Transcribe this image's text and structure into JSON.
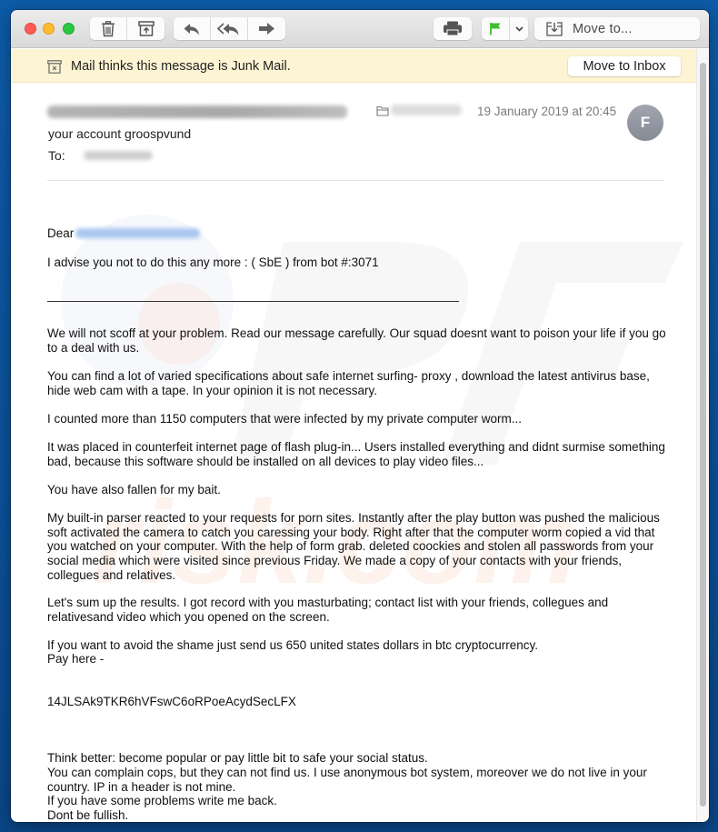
{
  "toolbar": {
    "buttons": [
      "trash",
      "archive",
      "reply",
      "reply-all",
      "forward",
      "print",
      "flag",
      "flag-menu"
    ],
    "move_to_label": "Move to...",
    "flag_color": "#3fbf2f"
  },
  "junk_banner": {
    "message": "Mail thinks this message is Junk Mail.",
    "move_to_inbox_label": "Move to Inbox",
    "background": "#fdf4d3"
  },
  "header": {
    "from": "[redacted sender]",
    "subject": "your account groospvund",
    "to_label": "To:",
    "to_value": "[redacted recipient]",
    "folder": "[redacted folder]",
    "date": "19 January 2019 at 20:45",
    "avatar_initial": "F"
  },
  "message": {
    "greeting": "Dear",
    "greeting_recipient": "[redacted email]",
    "line1": "I advise you not to do this any more :  ( SbE ) from bot #:3071",
    "paragraphs": [
      "We will not scoff at your problem. Read our message carefully. Our squad doesnt want to poison your life if you go to a deal with us.",
      "You can find a lot of varied specifications about safe internet surfing-  proxy , download the latest antivirus base, hide web cam with a tape. In your opinion it is not necessary.",
      "I counted more than 1150 computers that were infected by my private computer worm...",
      "It was placed in counterfeit internet page of flash plug-in... Users installed everything and didnt surmise something bad, because this software should be installed on all devices to play video files...",
      "You have also fallen for my bait.",
      "My built-in parser reacted to your requests for porn sites. Instantly after the play button was pushed the malicious soft activated the camera to catch you caressing your body. Right after that the computer worm copied a vid that you watched on your computer. With the help of form grab. deleted coockies and stolen all passwords from your social media which were visited since previous Friday. We made a copy of your contacts with your friends, collegues and relatives.",
      "Let's sum up the results. I got record with you masturbating; contact list with your friends, collegues and relativesand video which you opened on the screen.",
      "If you want to avoid the shame just send us 650 united states dollars in btc cryptocurrency.",
      "Pay here -",
      "14JLSAk9TKR6hVFswC6oRPoeAcydSecLFX",
      "Think better: become popular or pay little bit to safe your social status.",
      "You can complain cops, but they can not find us. I use anonymous bot system, moreover we do not live in your country. IP in a header is not mine.",
      "If you have some problems write me back.",
      "Dont be fullish."
    ]
  }
}
